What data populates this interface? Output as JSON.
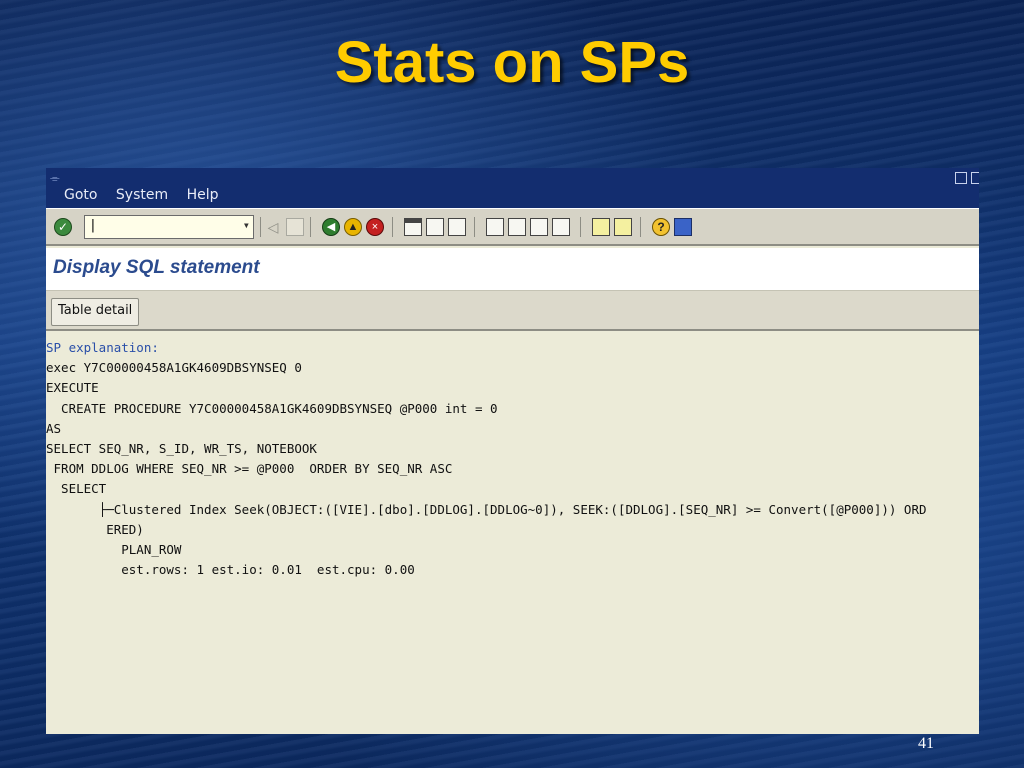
{
  "slide": {
    "title": "Stats on SPs",
    "page_number": "41"
  },
  "sap_window": {
    "menu": [
      "Goto",
      "System",
      "Help"
    ],
    "command_field": {
      "value": "|",
      "placeholder": ""
    },
    "screen_title": "Display SQL statement",
    "app_toolbar": {
      "table_detail_label": "Table detail"
    },
    "sql_lines": [
      "SP explanation:",
      "exec Y7C00000458A1GK4609DBSYNSEQ 0",
      "EXECUTE",
      "  CREATE PROCEDURE Y7C00000458A1GK4609DBSYNSEQ @P000 int = 0",
      "AS",
      "SELECT SEQ_NR, S_ID, WR_TS, NOTEBOOK",
      " FROM DDLOG WHERE SEQ_NR >= @P000  ORDER BY SEQ_NR ASC",
      "  SELECT",
      "       ├─Clustered Index Seek(OBJECT:([VIE].[dbo].[DDLOG].[DDLOG~0]), SEEK:([DDLOG].[SEQ_NR] >= Convert([@P000])) ORD",
      "        ERED)",
      "          PLAN_ROW",
      "          est.rows: 1 est.io: 0.01  est.cpu: 0.00"
    ],
    "icons": {
      "enter": "check-icon",
      "back": "back-arrow-icon",
      "exit": "up-arrow-icon",
      "cancel": "cancel-icon",
      "print": "print-icon",
      "find": "find-icon",
      "find_next": "find-next-icon",
      "first_page": "first-page-icon",
      "prev_page": "prev-page-icon",
      "next_page": "next-page-icon",
      "last_page": "last-page-icon",
      "help": "help-icon"
    },
    "colors": {
      "title_bar": "#132d6f",
      "screen_title": "#2b4b8e",
      "content_bg": "#ecebd8"
    }
  }
}
